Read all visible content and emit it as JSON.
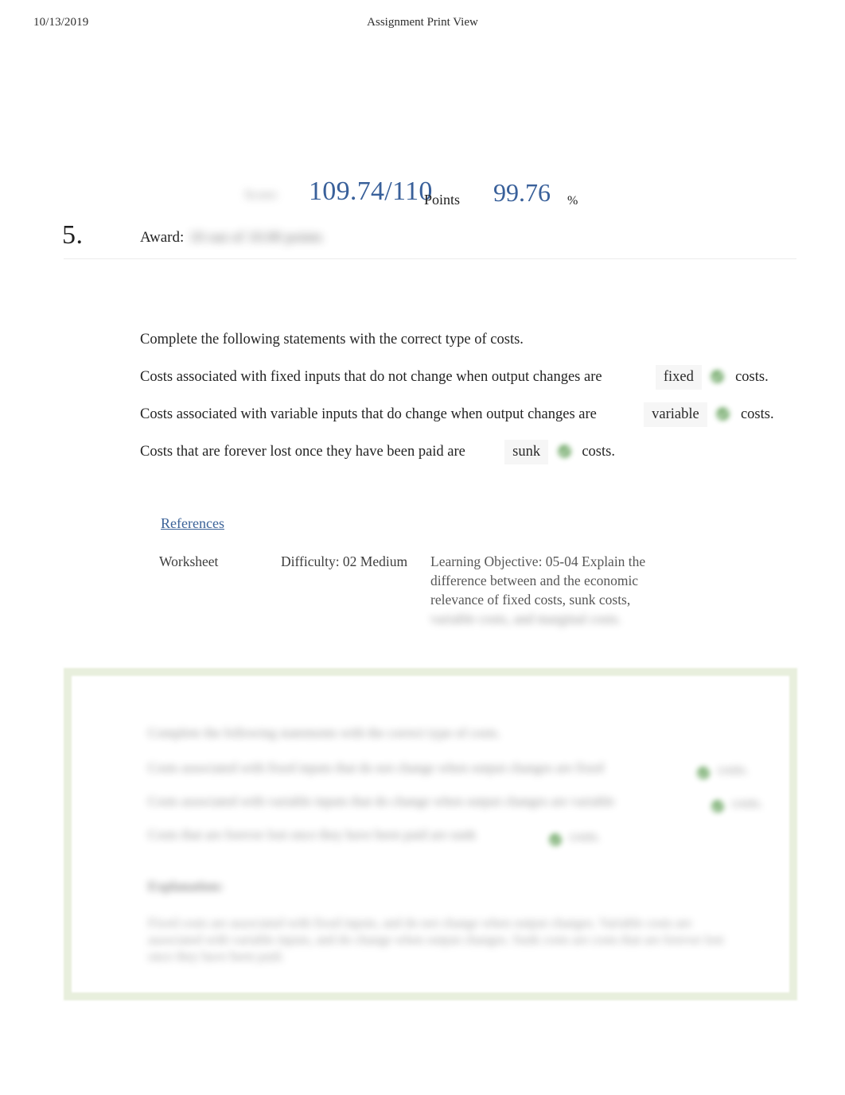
{
  "header": {
    "date": "10/13/2019",
    "doc_title": "Assignment Print View"
  },
  "score": {
    "label": "Score:",
    "points": "109.74/110",
    "points_unit": "Points",
    "percent": "99.76",
    "percent_unit": "%"
  },
  "question": {
    "number": "5.",
    "award_label": "Award:",
    "award_value": "10 out of 10.00 points",
    "stem": "Complete the following statements with the correct type of costs.",
    "statements": [
      {
        "text": "Costs associated with fixed inputs that do not change when output changes are",
        "answer": "fixed",
        "status_icon": "green-check-icon",
        "trailing": "costs."
      },
      {
        "text": "Costs associated with variable inputs that do change when output changes are",
        "answer": "variable",
        "status_icon": "green-check-icon",
        "trailing": "costs."
      },
      {
        "text": "Costs that are forever lost once they have been paid are",
        "answer": "sunk",
        "status_icon": "green-check-icon",
        "trailing": "costs."
      }
    ]
  },
  "references": {
    "link_label": "References",
    "worksheet": "Worksheet",
    "difficulty": "Difficulty: 02 Medium",
    "objective_visible": "Learning Objective: 05-04 Explain the difference between and the economic relevance of fixed costs, sunk costs,",
    "objective_blurred": "variable costs, and marginal costs."
  },
  "solution_panel": {
    "stem": "Complete the following statements with the correct type of costs.",
    "statement_1": "Costs associated with fixed inputs that do not change when output changes are fixed",
    "statement_2": "Costs associated with variable inputs that do change when output changes are variable",
    "statement_3": "Costs that are forever lost once they have been paid are sunk",
    "answer_1": "costs.",
    "answer_2": "costs.",
    "answer_3": "costs.",
    "explanation_heading": "Explanation:",
    "explanation_body": "Fixed costs are associated with fixed inputs, and do not change when output changes. Variable costs are associated with variable inputs, and do change when output changes. Sunk costs are costs that are forever lost once they have been paid."
  },
  "colors": {
    "score_blue": "#39609a",
    "link_blue": "#3b6298",
    "check_green": "#5a9b52",
    "panel_border_green": "#e8efdd",
    "field_gray": "#f6f6f6"
  }
}
